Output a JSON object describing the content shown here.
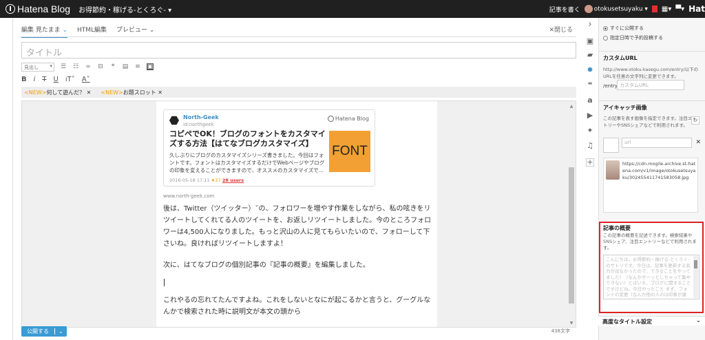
{
  "topbar": {
    "brand": "Hatena Blog",
    "blog_name": "お得節約・稼げる-とくろぐ-",
    "write_article": "記事を書く",
    "username": "otokusetsuyaku",
    "right_cut_text": "Hat"
  },
  "editor": {
    "tabs": [
      "編集 見たまま",
      "HTML編集",
      "プレビュー"
    ],
    "close_label": "閉じる",
    "title_placeholder": "タイトル",
    "heading_select": "見出し",
    "tags": [
      {
        "new": "<NEW>",
        "label": "何して遊んだ？"
      },
      {
        "new": "<NEW>",
        "label": "お題スロット"
      }
    ],
    "card": {
      "author": "North-Geek",
      "author_id": "id:northgeek",
      "brand": "Hatena Blog",
      "title": "コピペでOK！ブログのフォントをカスタマイズする方法【はてなブログカスタマイズ】",
      "excerpt": "久しぶりにブログのカスタマイズシリーズ書きました。今回はフォントです。フォントはカスタマイズするだけでWebページやブログの印象を変えることができますので、オススメのカスタマイズで...",
      "date": "2016-05-18 17:11",
      "stars": "★27",
      "users": "28 users",
      "thumb_text": "FONT"
    },
    "source_url": "www.north-geek.com",
    "paragraph1": "後は、Twitter（ツイッター）˘の、フォロワーを増やす作業をしながら、私の呟きをリツイートしてくれてる人のツイートを、お返しリツイートしました。今のところフォロワーは4,500人になりました。もっと沢山の人に見てもらいたいので、フォローして下さいね。良ければリツイートしますよ！",
    "paragraph2": "次に、はてなブログの個別記事の『記事の概要』を編集しました。",
    "paragraph3": "これやるの忘れてたんですよね。これをしないとなにが起こるかと言うと、グーグルなんかで検索された時に説明文が本文の頭から",
    "publish_label": "公開する",
    "word_count": "438文字"
  },
  "panel": {
    "publish_now": "すぐに公開する",
    "schedule": "指定日時で予約投稿する",
    "custom_url_title": "カスタムURL",
    "custom_url_desc": "http://www.otoku-kasegu.com/entry/以下のURLを任意の文字列に変更できます。",
    "custom_url_prefix": "/entry/",
    "custom_url_placeholder": "カスタムURL",
    "eyecatch_title": "アイキャッチ画像",
    "eyecatch_desc": "この記事を表す画像を指定できます。注目エントリーやSNSシェアなどで利用されます。",
    "eyecatch_url_placeholder": "url",
    "eyecatch_image_url": "https://cdn.mogile.archive.st-hatena.com/v1/image/otokusetsuyaku/302455411741583058.jpg",
    "summary_title": "記事の概要",
    "summary_desc": "この記事の概要を記述できます。検索結果やSNSシェア、注目エントリーなどで利用されます。",
    "summary_text": "こんにちは。お得節約・稼げる-とくろぐ-のサトリです。今日は、記事を更新する気力が出なかったので、できることをやってました！（なんかボーッとしちゃって集中できない）とはいえ、ブログに関することですけどね。今日やったこと まず、フォントの変更（なんか他の人のは印象が違う）からわたしか",
    "adv_title": "高度なタイトル設定"
  },
  "colors": {
    "accent": "#3a8fc9",
    "highlight": "#e02020",
    "thumb": "#f2a033"
  }
}
